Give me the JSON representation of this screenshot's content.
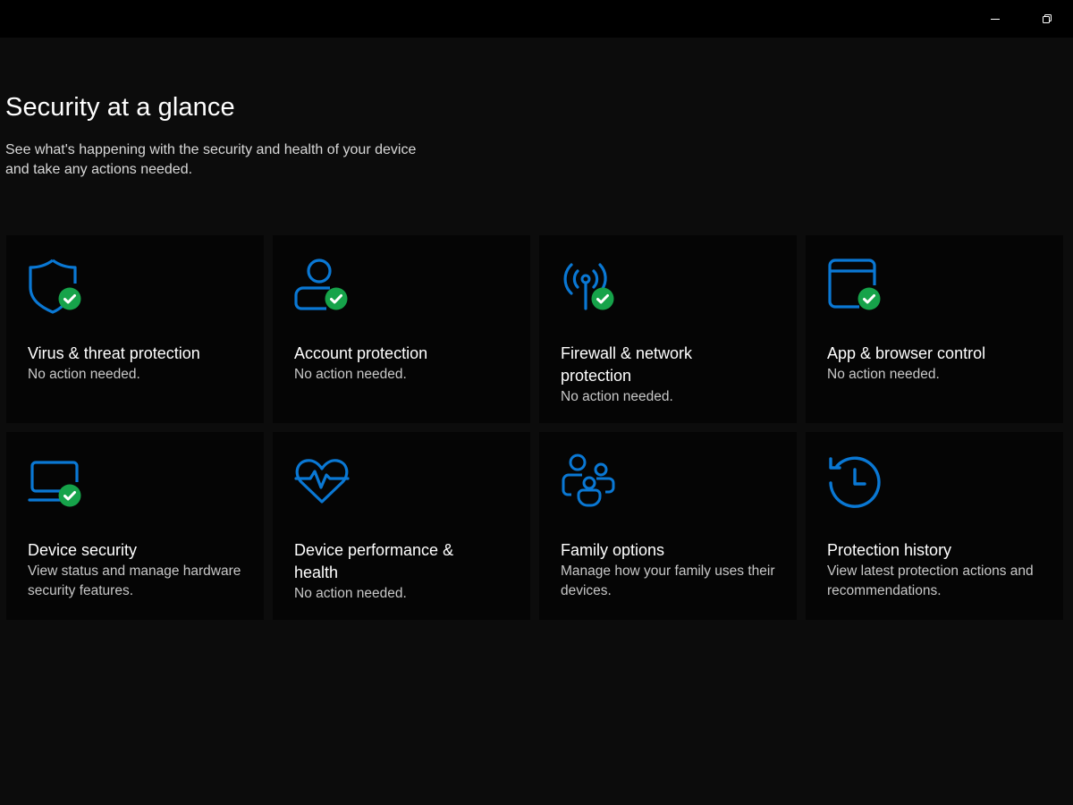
{
  "window": {
    "minimize_icon": "minimize-icon",
    "restore_icon": "restore-icon"
  },
  "header": {
    "title": "Security at a glance",
    "subtitle": "See what's happening with the security and health of your device and take any actions needed."
  },
  "colors": {
    "accent": "#0a78d4",
    "ok_green": "#16a34a",
    "background": "#0c0c0c",
    "tile_background": "#050505"
  },
  "tiles": [
    {
      "title": "Virus & threat protection",
      "description": "No action needed.",
      "icon": "shield-icon",
      "status": "ok"
    },
    {
      "title": "Account protection",
      "description": "No action needed.",
      "icon": "person-icon",
      "status": "ok"
    },
    {
      "title": "Firewall & network protection",
      "description": "No action needed.",
      "icon": "antenna-icon",
      "status": "ok"
    },
    {
      "title": "App & browser control",
      "description": "No action needed.",
      "icon": "browser-window-icon",
      "status": "ok"
    },
    {
      "title": "Device security",
      "description": "View status and manage hardware security features.",
      "icon": "laptop-icon",
      "status": "ok"
    },
    {
      "title": "Device performance & health",
      "description": "No action needed.",
      "icon": "heart-pulse-icon",
      "status": "none"
    },
    {
      "title": "Family options",
      "description": "Manage how your family uses their devices.",
      "icon": "family-icon",
      "status": "none"
    },
    {
      "title": "Protection history",
      "description": "View latest protection actions and recommendations.",
      "icon": "history-clock-icon",
      "status": "none"
    }
  ]
}
